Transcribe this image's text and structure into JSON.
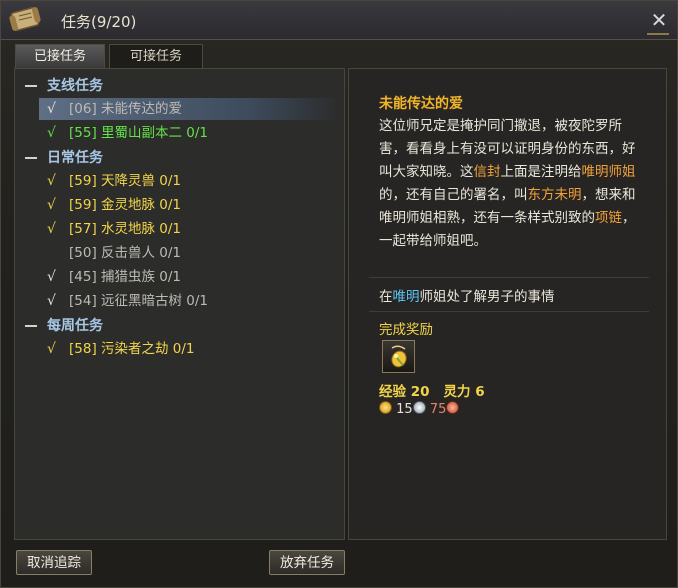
{
  "window": {
    "title": "任务(9/20)",
    "close_label": "✕"
  },
  "tabs": [
    {
      "label": "已接任务"
    },
    {
      "label": "可接任务"
    }
  ],
  "quest_list": {
    "categories": [
      {
        "label": "支线任务"
      },
      {
        "label": "日常任务"
      },
      {
        "label": "每周任务"
      }
    ],
    "quests": [
      {
        "label": "[06] 未能传达的爱",
        "check": "√"
      },
      {
        "label": "[55] 里蜀山副本二 0/1",
        "check": "√"
      },
      {
        "label": "[59] 天降灵兽 0/1",
        "check": "√"
      },
      {
        "label": "[59] 金灵地脉 0/1",
        "check": "√"
      },
      {
        "label": "[57] 水灵地脉 0/1",
        "check": "√"
      },
      {
        "label": "[50] 反击兽人 0/1",
        "check": ""
      },
      {
        "label": "[45] 捕猎虫族 0/1",
        "check": "√"
      },
      {
        "label": "[54] 远征黑暗古树 0/1",
        "check": "√"
      },
      {
        "label": "[58] 污染者之劫 0/1",
        "check": "√"
      }
    ]
  },
  "detail": {
    "title": "未能传达的爱",
    "desc_segments": [
      "这位师兄定是掩护同门撤退，被夜陀罗所害，看看身上有没可以证明身份的东西，好叫大家知晓。这",
      "信封",
      "上面是注明给",
      "唯明师姐",
      "的，还有自己的署名，叫",
      "东方未明",
      "，想来和唯明师姐相熟，还有一条样式别致的",
      "项链",
      "，一起带给师姐吧。"
    ],
    "target_segments": [
      "在",
      "唯明",
      "师姐处了解男子的事情"
    ],
    "reward_title": "完成奖励",
    "exp_label": "经验 20",
    "spirit_label": "灵力 6",
    "money": {
      "gold": "15",
      "silver": "",
      "copper": "75"
    }
  },
  "buttons": {
    "cancel_track": "取消追踪",
    "abandon": "放弃任务"
  },
  "colors": {
    "daily_yellow": "#f2d54a",
    "branch_green": "#63e34a",
    "disabled_gray": "#bdbab2",
    "category_blue": "#a8c7e6",
    "highlight_orange": "#f2a23a",
    "highlight_blue": "#5ec6f6"
  }
}
